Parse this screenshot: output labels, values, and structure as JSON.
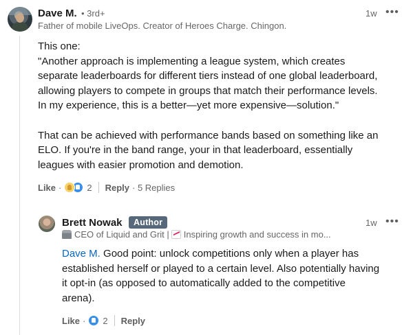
{
  "top_comment": {
    "author": "Dave M.",
    "degree": "• 3rd+",
    "headline": "Father of mobile LiveOps. Creator of Heroes Charge. Chingon.",
    "time": "1w",
    "more": "•••",
    "body": [
      "This one:",
      "\"Another approach is implementing a league system, which creates",
      "separate leaderboards for different tiers instead of one global leaderboard,",
      "allowing players to compete in groups that match their performance levels.",
      "In my experience, this is a better—yet more expensive—solution.\"",
      "",
      "That can be achieved with performance bands based on something like an",
      "ELO. If you're in the band range, your in that leaderboard, essentially",
      "leagues with easier promotion and demotion."
    ],
    "like_label": "Like",
    "dot": "·",
    "reaction_count": "2",
    "reactions": [
      "celebrate-icon",
      "like-icon"
    ],
    "reply_label": "Reply",
    "replies_text": "· 5 Replies"
  },
  "reply": {
    "author": "Brett Nowak",
    "badge": "Author",
    "headline_part1": "CEO of Liquid and Grit | ",
    "headline_part2": "Inspiring growth and success in mo...",
    "time": "1w",
    "more": "•••",
    "mention": "Dave M.",
    "body_first": " Good point: unlock competitions only when a player has",
    "body": [
      "established herself or played to a certain level. Also potentially having",
      "it opt-in (as opposed to automatically added to the competitive",
      "arena)."
    ],
    "like_label": "Like",
    "dot": "·",
    "reaction_count": "2",
    "reactions": [
      "like-icon"
    ],
    "reply_label": "Reply"
  },
  "colors": {
    "link": "#0a66c2",
    "badge_bg": "#56687a",
    "secondary_text": "#666666",
    "like_blue": "#378fe9",
    "celebrate_yellow": "#f6d36a"
  }
}
